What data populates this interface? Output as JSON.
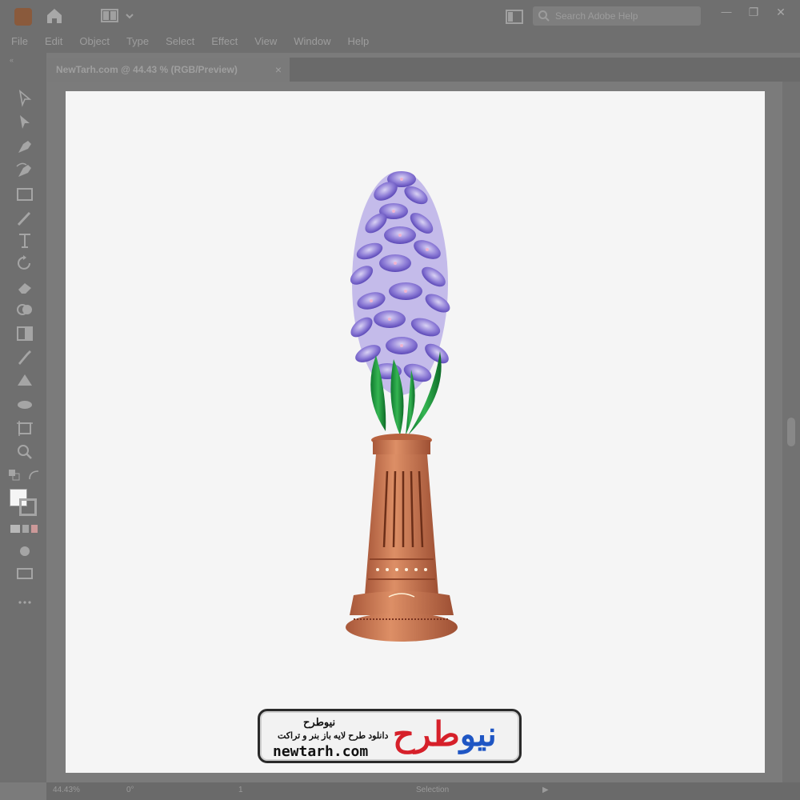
{
  "window": {
    "search_placeholder": "Search Adobe Help",
    "minimize_glyph": "—",
    "maximize_glyph": "❐",
    "close_glyph": "✕"
  },
  "menu": {
    "items": [
      "File",
      "Edit",
      "Object",
      "Type",
      "Select",
      "Effect",
      "View",
      "Window",
      "Help"
    ]
  },
  "document": {
    "tab_label": "NewTarh.com @ 44.43 % (RGB/Preview)",
    "close_glyph": "×"
  },
  "toolbar": {
    "collapse_glyph": "«",
    "tools": [
      "selection-tool",
      "direct-selection-tool",
      "pen-tool",
      "curvature-tool",
      "rectangle-tool",
      "paintbrush-tool",
      "type-tool",
      "rotate-tool",
      "eraser-tool",
      "shape-builder-tool",
      "gradient-tool",
      "eyedropper-tool",
      "blend-tool",
      "symbol-sprayer-tool",
      "artboard-tool",
      "zoom-tool"
    ]
  },
  "status": {
    "zoom": "44.43%",
    "rotation": "0°",
    "page": "1",
    "mode": "Selection"
  },
  "watermark": {
    "brand_fa": "نیوطرح",
    "tagline_fa": "دانلود طرح لایه باز بنر و تراکت",
    "url": "newtarh.com",
    "logo_part1": "نیو",
    "logo_part2": "طرح",
    "logo_red": "#d6202a",
    "logo_blue": "#1f56c4"
  },
  "colors": {
    "chrome": "#6f6f6f",
    "artboard": "#f5f5f5"
  }
}
